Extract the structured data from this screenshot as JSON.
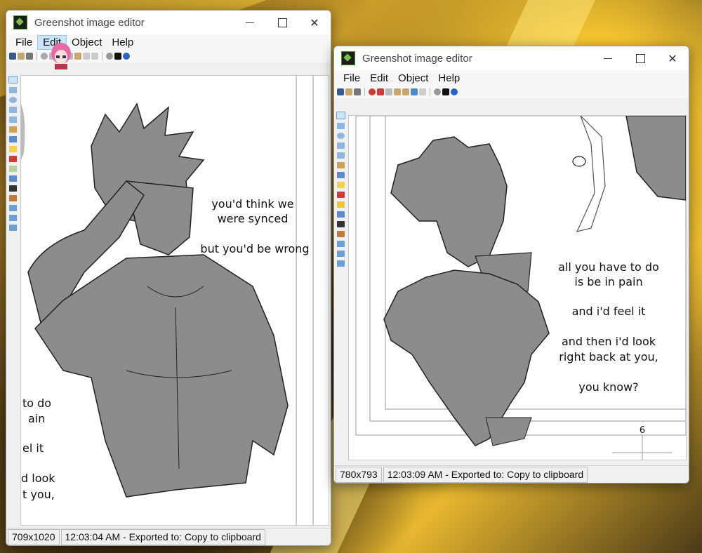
{
  "windows": [
    {
      "title": "Greenshot image editor",
      "menu": [
        "File",
        "Edit",
        "Object",
        "Help"
      ],
      "active_menu": "Edit",
      "status": {
        "size": "709x1020",
        "message": "12:03:04 AM - Exported to: Copy to clipboard"
      },
      "comic": {
        "speech": [
          "you'd think we",
          "were synced",
          "but you'd be wrong"
        ],
        "cut_text": [
          "to do",
          "ain",
          "el it",
          "d look",
          "t you,"
        ]
      }
    },
    {
      "title": "Greenshot image editor",
      "menu": [
        "File",
        "Edit",
        "Object",
        "Help"
      ],
      "status": {
        "size": "780x793",
        "message": "12:03:09 AM - Exported to: Copy to clipboard"
      },
      "comic": {
        "speech": [
          "all you have to do",
          "is be in pain",
          "and i'd feel it",
          "and then i'd look",
          "right back at you,",
          "you know?"
        ],
        "page_number": "6"
      }
    }
  ],
  "colors": {
    "accent": "#cce4f7",
    "fill_gray": "#8c8c8c"
  }
}
